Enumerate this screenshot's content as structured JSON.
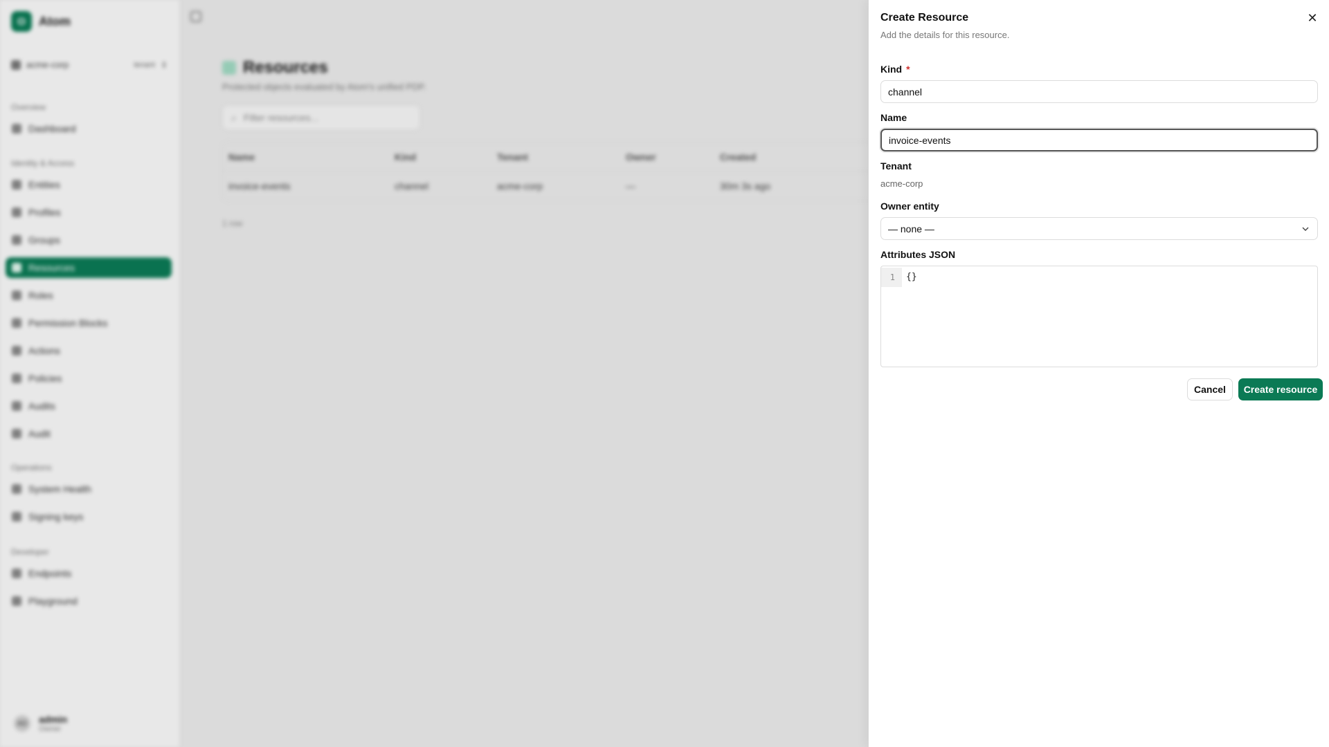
{
  "app": {
    "brand_initial": "O",
    "brand_name": "Atom",
    "tenant": "acme-corp",
    "tenant_tag": "tenant",
    "sections": {
      "overview": "Overview",
      "identity": "Identity & Access",
      "operations": "Operations",
      "developer": "Developer"
    },
    "nav": {
      "dashboard": "Dashboard",
      "entities": "Entities",
      "profiles": "Profiles",
      "groups": "Groups",
      "resources": "Resources",
      "roles": "Roles",
      "permission_blocks": "Permission Blocks",
      "actions": "Actions",
      "policies": "Policies",
      "audits": "Audits",
      "audit": "Audit",
      "system_health": "System Health",
      "signing_keys": "Signing keys",
      "endpoints": "Endpoints",
      "playground": "Playground"
    },
    "user": {
      "initials": "AD",
      "name": "admin",
      "role": "Owner"
    }
  },
  "page": {
    "title": "Resources",
    "subtitle": "Protected objects evaluated by Atom's unified PDP.",
    "filter_placeholder": "Filter resources...",
    "columns": [
      "Name",
      "Kind",
      "Tenant",
      "Owner",
      "Created"
    ],
    "rows": [
      [
        "invoice-events",
        "channel",
        "acme-corp",
        "—",
        "30m 3s ago"
      ]
    ],
    "row_count": "1 row"
  },
  "drawer": {
    "title": "Create Resource",
    "subtitle": "Add the details for this resource.",
    "kind_label": "Kind",
    "required_mark": "*",
    "kind_value": "channel",
    "name_label": "Name",
    "name_value": "invoice-events",
    "tenant_label": "Tenant",
    "tenant_value": "acme-corp",
    "owner_label": "Owner entity",
    "owner_value": "— none —",
    "attributes_label": "Attributes JSON",
    "line_number": "1",
    "attributes_value": "{}",
    "cancel_label": "Cancel",
    "create_label": "Create resource",
    "close_glyph": "✕"
  },
  "colors": {
    "accent": "#0b7a55",
    "required": "#d0312d"
  }
}
